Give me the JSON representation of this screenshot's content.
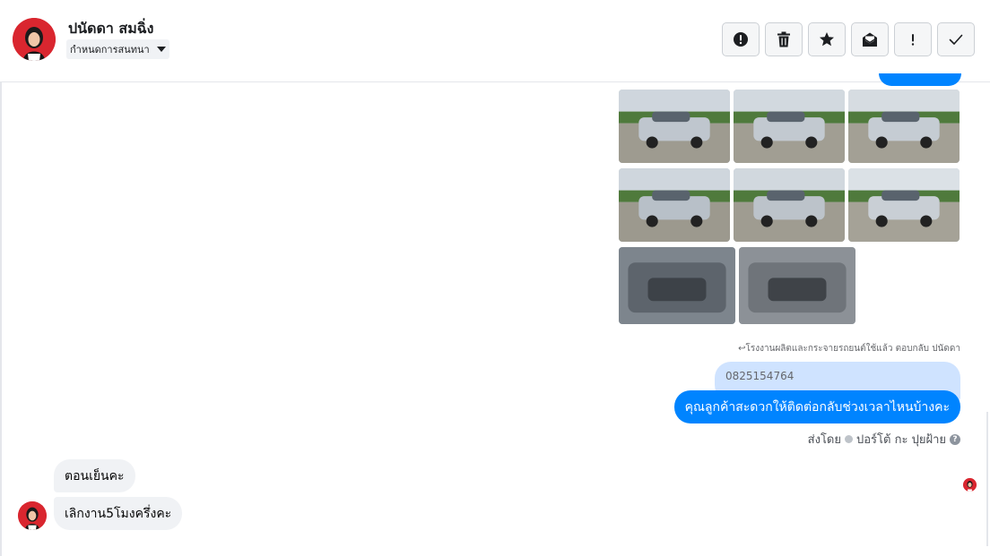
{
  "header": {
    "contact_name": "ปนัดดา สมฉิ่ง",
    "assign_label": "กำหนดการสนทนา",
    "actions": [
      {
        "name": "spam-button",
        "icon": "alert-circle-icon"
      },
      {
        "name": "delete-button",
        "icon": "trash-icon"
      },
      {
        "name": "star-button",
        "icon": "star-icon"
      },
      {
        "name": "mark-unread-button",
        "icon": "envelope-open-icon"
      },
      {
        "name": "priority-button",
        "icon": "exclamation-icon"
      },
      {
        "name": "mark-done-button",
        "icon": "check-icon"
      }
    ]
  },
  "thread": {
    "photos": [
      {
        "subject": "pickup-truck-front-left",
        "body_color": "#bfc6ce",
        "sky": "#cfd6dd",
        "ground": "#9e9b90"
      },
      {
        "subject": "pickup-truck-front",
        "body_color": "#c2c9d0",
        "sky": "#d2d9df",
        "ground": "#a19e93"
      },
      {
        "subject": "pickup-truck-front-right",
        "body_color": "#c5ccd3",
        "sky": "#d6dce1",
        "ground": "#a3a095"
      },
      {
        "subject": "pickup-truck-rear-left",
        "body_color": "#b8c0c8",
        "sky": "#cfd6dd",
        "ground": "#9c998e"
      },
      {
        "subject": "pickup-truck-rear",
        "body_color": "#bcc3ca",
        "sky": "#d1d8de",
        "ground": "#9f9c91"
      },
      {
        "subject": "pickup-truck-side",
        "body_color": "#c9cfd5",
        "sky": "#dbe1e6",
        "ground": "#a5a297"
      },
      {
        "subject": "door-panel-interior",
        "body_color": "#5d646c",
        "sky": "#7d858d",
        "ground": "#3d4248"
      },
      {
        "subject": "engine-bay",
        "body_color": "#6f747a",
        "sky": "#8c9197",
        "ground": "#3f4348"
      }
    ],
    "reply_byline": "↩โรงงานผลิตและกระจายรถยนต์ใช้แล้ว ตอบกลับ ปนัดดา",
    "quoted_text": "0825154764",
    "outgoing_message": "คุณลูกค้าสะดวกให้ติดต่อกลับช่วงเวลาไหนบ้างคะ",
    "sent_by_prefix": "ส่งโดย",
    "sent_by_name": "ปอร์โต้ กะ ปุยฝ้าย",
    "incoming_messages": [
      "ตอนเย็นคะ",
      "เลิกงาน5โมงครึ่งคะ"
    ]
  },
  "colors": {
    "accent": "#0084ff",
    "quoted_bg": "#cfe3ff",
    "incoming_bg": "#f0f2f5",
    "avatar_red": "#d9262f"
  }
}
